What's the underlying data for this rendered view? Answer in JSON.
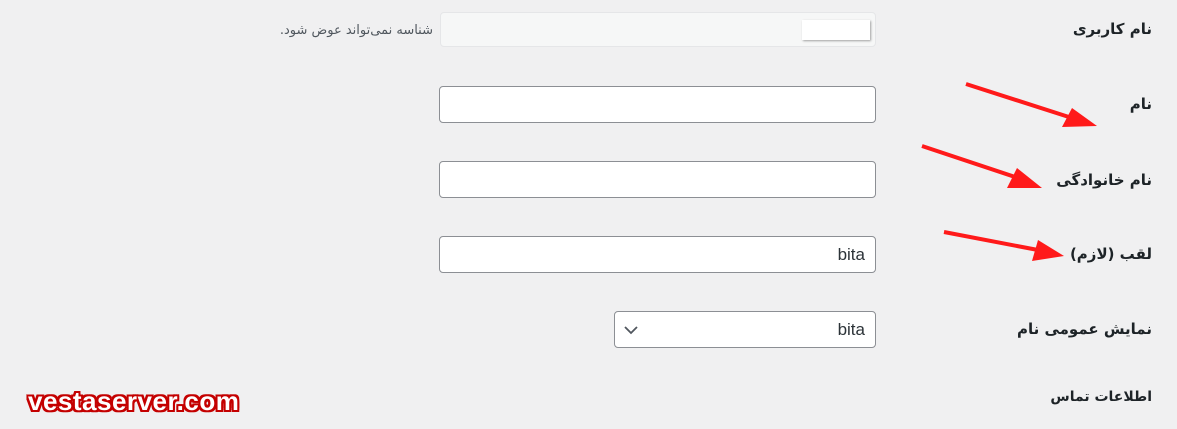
{
  "fields": {
    "username": {
      "label": "نام کاربری",
      "note": "شناسه نمی‌تواند عوض شود."
    },
    "first_name": {
      "label": "نام",
      "value": ""
    },
    "last_name": {
      "label": "نام خانوادگی",
      "value": ""
    },
    "nickname": {
      "label": "لقب (لازم)",
      "value": "bita"
    },
    "display_name": {
      "label": "نمایش عمومی نام",
      "selected": "bita"
    }
  },
  "section_contact": {
    "heading": "اطلاعات تماس"
  },
  "watermark": {
    "text": "vestaserver.com"
  },
  "colors": {
    "arrow": "#ff1a1a",
    "watermark_outline": "#c40000",
    "background": "#f0f0f1"
  }
}
